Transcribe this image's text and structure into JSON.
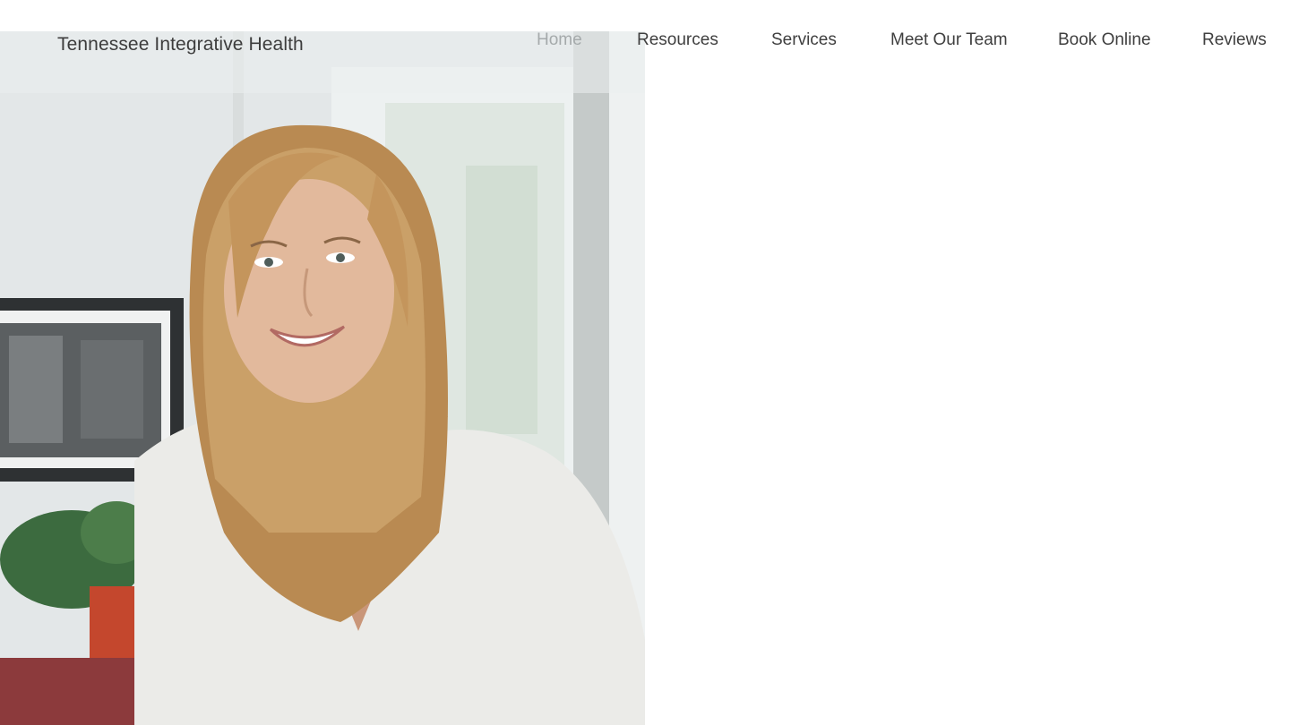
{
  "site": {
    "title": "Tennessee Integrative Health"
  },
  "nav": {
    "items": [
      {
        "label": "Home",
        "active": true
      },
      {
        "label": "Resources",
        "active": false
      },
      {
        "label": "Services",
        "active": false
      },
      {
        "label": "Meet Our Team",
        "active": false
      },
      {
        "label": "Book Online",
        "active": false
      },
      {
        "label": "Reviews",
        "active": false
      }
    ]
  },
  "hero": {
    "image": "smiling-woman-portrait-photo"
  },
  "colors": {
    "nav_text": "#3f3f3f",
    "nav_active": "#a5aaab",
    "logo_text": "#3d3d3d",
    "background": "#ffffff"
  }
}
